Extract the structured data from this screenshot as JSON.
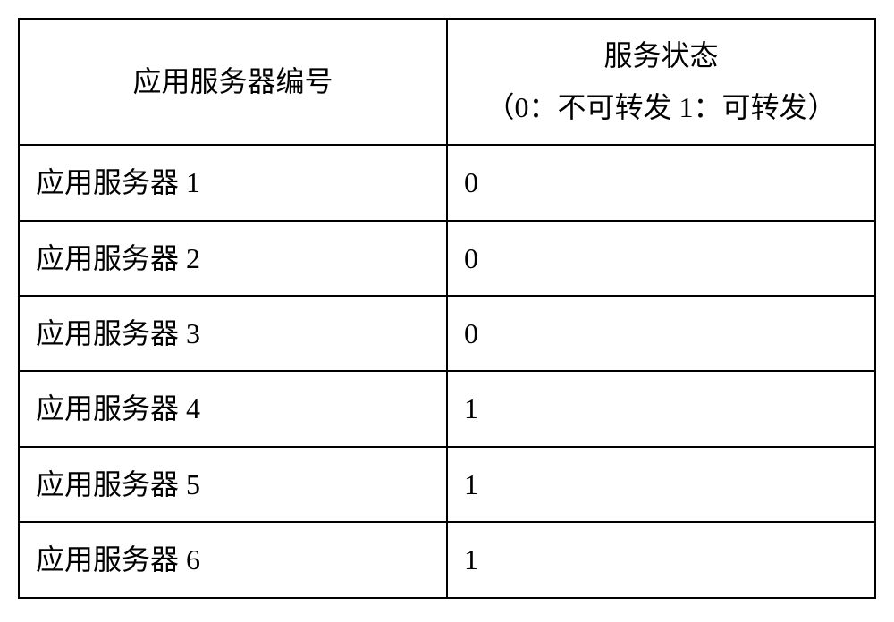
{
  "table": {
    "headers": {
      "col1": "应用服务器编号",
      "col2_line1": "服务状态",
      "col2_line2": "（0：不可转发 1：可转发）"
    },
    "rows": [
      {
        "server": "应用服务器 1",
        "status": "0"
      },
      {
        "server": "应用服务器 2",
        "status": "0"
      },
      {
        "server": "应用服务器 3",
        "status": "0"
      },
      {
        "server": "应用服务器 4",
        "status": "1"
      },
      {
        "server": "应用服务器 5",
        "status": "1"
      },
      {
        "server": "应用服务器 6",
        "status": "1"
      }
    ]
  }
}
